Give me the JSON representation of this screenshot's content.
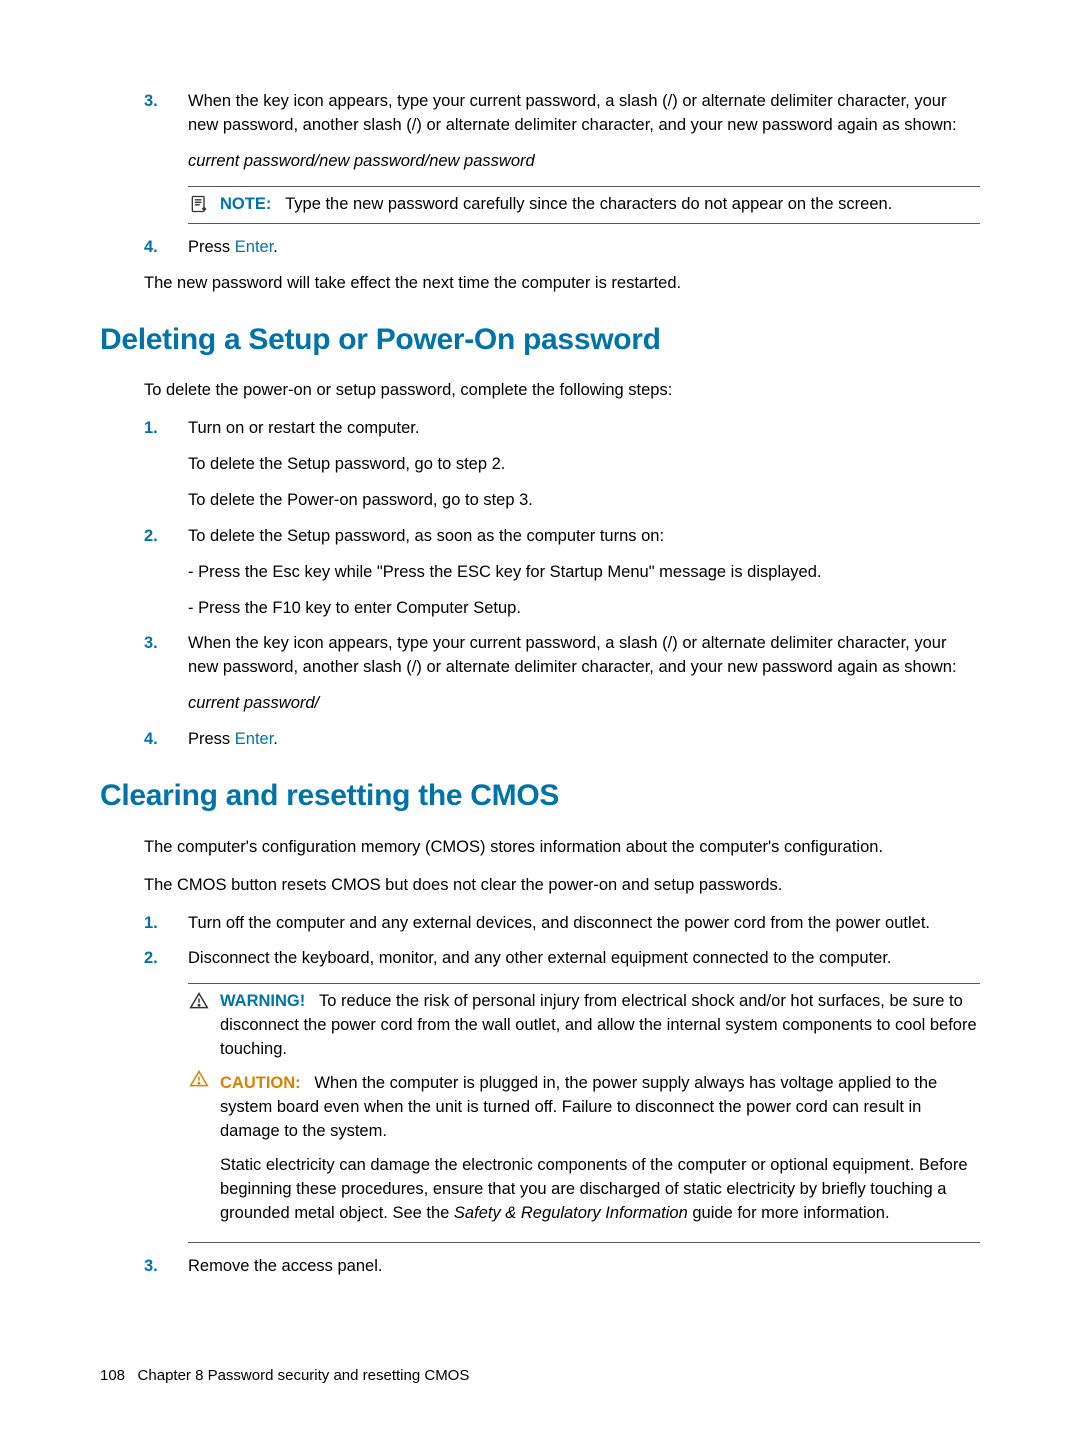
{
  "top": {
    "step3": {
      "num": "3.",
      "text": "When the key icon appears, type your current password, a slash (/) or alternate delimiter character, your new password, another slash (/) or alternate delimiter character, and your new password again as shown:",
      "example": "current password/new password/new password"
    },
    "note": {
      "label": "NOTE:",
      "text": "Type the new password carefully since the characters do not appear on the screen."
    },
    "step4": {
      "num": "4.",
      "pre": "Press ",
      "key": "Enter",
      "post": "."
    },
    "outro": "The new password will take effect the next time the computer is restarted."
  },
  "deleting": {
    "heading": "Deleting a Setup or Power-On password",
    "intro": "To delete the power-on or setup password, complete the following steps:",
    "step1": {
      "num": "1.",
      "text": "Turn on or restart the computer.",
      "sub1": "To delete the Setup password, go to step 2.",
      "sub2": "To delete the Power-on password, go to step 3."
    },
    "step2": {
      "num": "2.",
      "text": "To delete the Setup password, as soon as the computer turns on:",
      "sub1": "- Press the Esc key while \"Press the ESC key for Startup Menu\" message is displayed.",
      "sub2": "- Press the F10 key to enter Computer Setup."
    },
    "step3": {
      "num": "3.",
      "text": "When the key icon appears, type your current password, a slash (/) or alternate delimiter character, your new password, another slash (/) or alternate delimiter character, and your new password again as shown:",
      "example": "current password/"
    },
    "step4": {
      "num": "4.",
      "pre": "Press ",
      "key": "Enter",
      "post": "."
    }
  },
  "clearing": {
    "heading": "Clearing and resetting the CMOS",
    "intro1": "The computer's configuration memory (CMOS) stores information about the computer's configuration.",
    "intro2": "The CMOS button resets CMOS but does not clear the power-on and setup passwords.",
    "step1": {
      "num": "1.",
      "text": "Turn off the computer and any external devices, and disconnect the power cord from the power outlet."
    },
    "step2": {
      "num": "2.",
      "text": "Disconnect the keyboard, monitor, and any other external equipment connected to the computer."
    },
    "warning": {
      "label": "WARNING!",
      "text": "To reduce the risk of personal injury from electrical shock and/or hot surfaces, be sure to disconnect the power cord from the wall outlet, and allow the internal system components to cool before touching."
    },
    "caution": {
      "label": "CAUTION:",
      "text": "When the computer is plugged in, the power supply always has voltage applied to the system board even when the unit is turned off. Failure to disconnect the power cord can result in damage to the system.",
      "text2_pre": "Static electricity can damage the electronic components of the computer or optional equipment. Before beginning these procedures, ensure that you are discharged of static electricity by briefly touching a grounded metal object. See the ",
      "text2_em": "Safety & Regulatory Information",
      "text2_post": " guide for more information."
    },
    "step3": {
      "num": "3.",
      "text": "Remove the access panel."
    }
  },
  "footer": {
    "page": "108",
    "chapter": "Chapter 8   Password security and resetting CMOS"
  }
}
